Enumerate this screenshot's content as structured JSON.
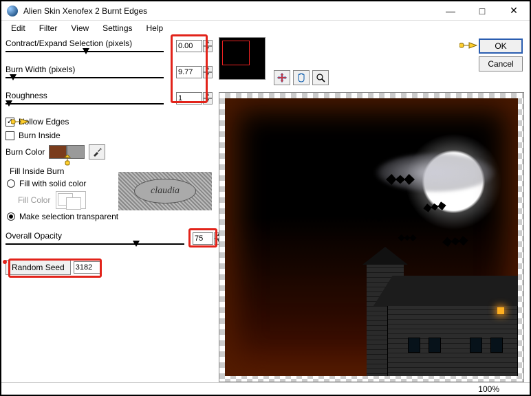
{
  "window": {
    "title": "Alien Skin Xenofex 2 Burnt Edges",
    "min": "—",
    "max": "□",
    "close": "✕"
  },
  "menu": {
    "edit": "Edit",
    "filter": "Filter",
    "view": "View",
    "settings": "Settings",
    "help": "Help"
  },
  "fields": {
    "contract_label": "Contract/Expand Selection (pixels)",
    "contract_value": "0.00",
    "burnwidth_label": "Burn Width (pixels)",
    "burnwidth_value": "9.77",
    "roughness_label": "Roughness",
    "roughness_value": "1",
    "hollow_label": "Hollow Edges",
    "burninside_label": "Burn Inside",
    "burncolor_label": "Burn Color",
    "fillinside_label": "Fill Inside Burn",
    "fillsolid_label": "Fill with solid color",
    "fillcolor_label": "Fill Color",
    "maketrans_label": "Make selection transparent",
    "opacity_label": "Overall Opacity",
    "opacity_value": "75",
    "randseed_label": "Random Seed",
    "randseed_value": "3182"
  },
  "buttons": {
    "ok": "OK",
    "cancel": "Cancel"
  },
  "watermark": "claudia",
  "status": {
    "zoom": "100%"
  },
  "colors": {
    "burn_primary": "#7a3c1c",
    "burn_secondary": "#9a9a9a"
  }
}
